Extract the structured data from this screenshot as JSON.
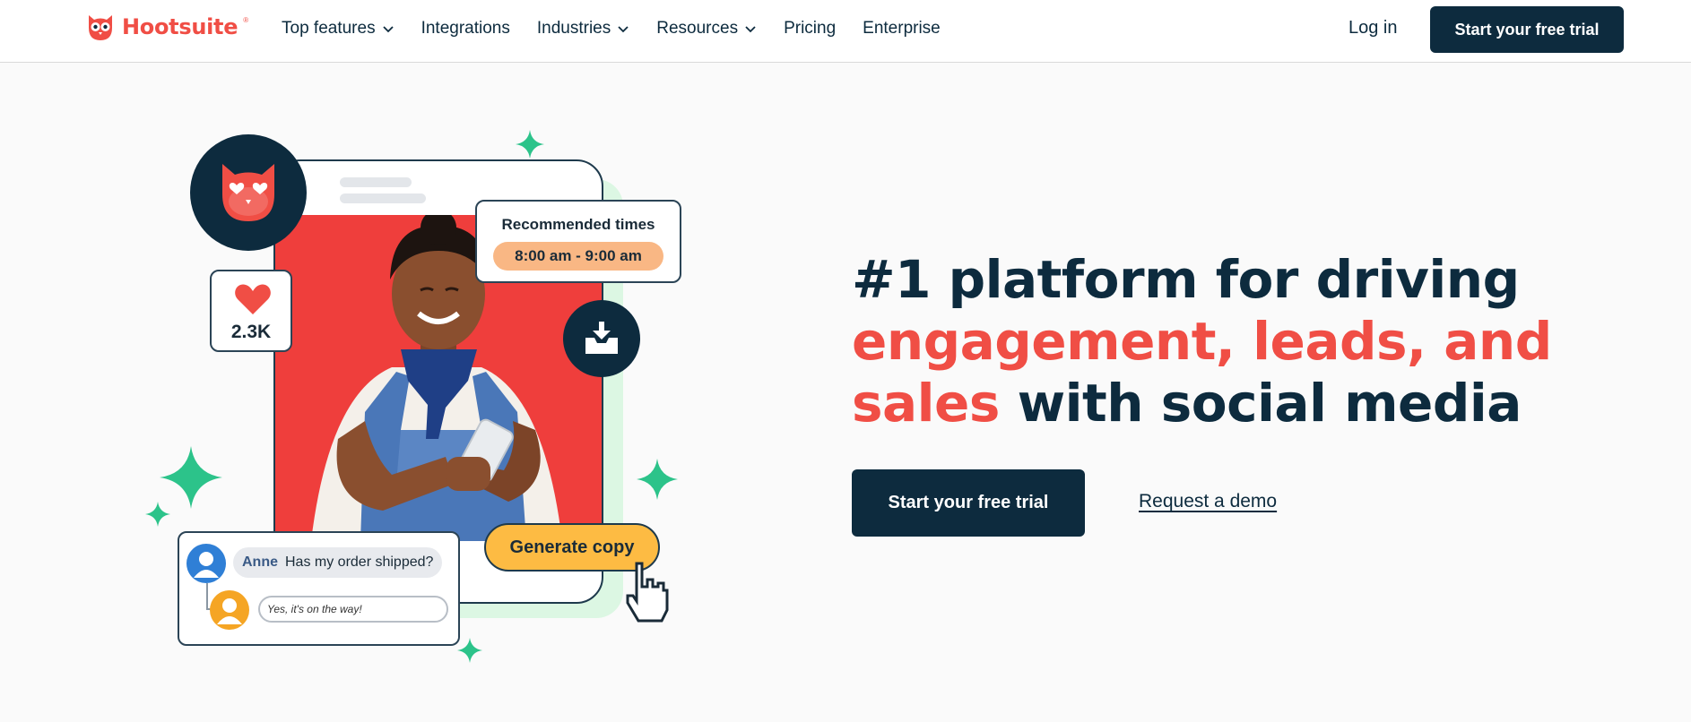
{
  "nav": {
    "logo_text": "Hootsuite",
    "logo_tm": "®",
    "items": [
      {
        "label": "Top features",
        "has_dropdown": true
      },
      {
        "label": "Integrations",
        "has_dropdown": false
      },
      {
        "label": "Industries",
        "has_dropdown": true
      },
      {
        "label": "Resources",
        "has_dropdown": true
      },
      {
        "label": "Pricing",
        "has_dropdown": false
      },
      {
        "label": "Enterprise",
        "has_dropdown": false
      }
    ],
    "login": "Log in",
    "cta": "Start your free trial"
  },
  "hero": {
    "headline_part1": "#1 platform for driving",
    "headline_highlight1": "engagement, leads, and",
    "headline_highlight2": "sales",
    "headline_part2": " with social media",
    "cta": "Start your free trial",
    "demo_link": "Request a demo"
  },
  "illustration": {
    "recommended_title": "Recommended times",
    "recommended_time": "8:00 am - 9:00 am",
    "likes_count": "2.3K",
    "message_name": "Anne",
    "message_text": "Has my order shipped?",
    "reply_text": "Yes, it's on the way!",
    "generate_button": "Generate copy"
  },
  "colors": {
    "brand_red": "#f04e45",
    "navy": "#0d2b3e",
    "sparkle_green": "#2cc38a",
    "pill_orange": "#f9b784",
    "button_yellow": "#fdbb43"
  }
}
